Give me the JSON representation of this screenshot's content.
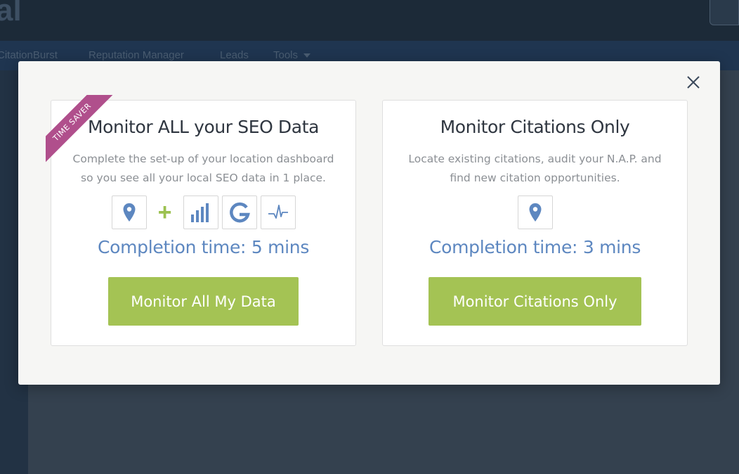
{
  "app": {
    "logo_fragment": "al",
    "nav": {
      "citation_burst": "CitationBurst",
      "reputation_manager": "Reputation Manager",
      "leads": "Leads",
      "tools": "Tools"
    }
  },
  "modal": {
    "close_icon": "close-icon",
    "left_card": {
      "ribbon": "TIME SAVER",
      "title": "Monitor ALL your SEO Data",
      "description": "Complete the set-up of your location dashboard so you see all your local SEO data in 1 place.",
      "icons": [
        "map-pin-icon",
        "bar-chart-icon",
        "google-icon",
        "pulse-icon"
      ],
      "plus": "+",
      "completion_time": "Completion time: 5 mins",
      "button_label": "Monitor All My Data"
    },
    "right_card": {
      "title": "Monitor Citations Only",
      "description": "Locate existing citations, audit your N.A.P. and find new citation opportunities.",
      "icons": [
        "map-pin-icon"
      ],
      "completion_time": "Completion time: 3 mins",
      "button_label": "Monitor Citations Only"
    }
  },
  "colors": {
    "accent_green": "#a4c354",
    "accent_blue": "#5d87c0",
    "ribbon_pink": "#b04f8c",
    "overlay_dark": "#2e3d4e"
  }
}
